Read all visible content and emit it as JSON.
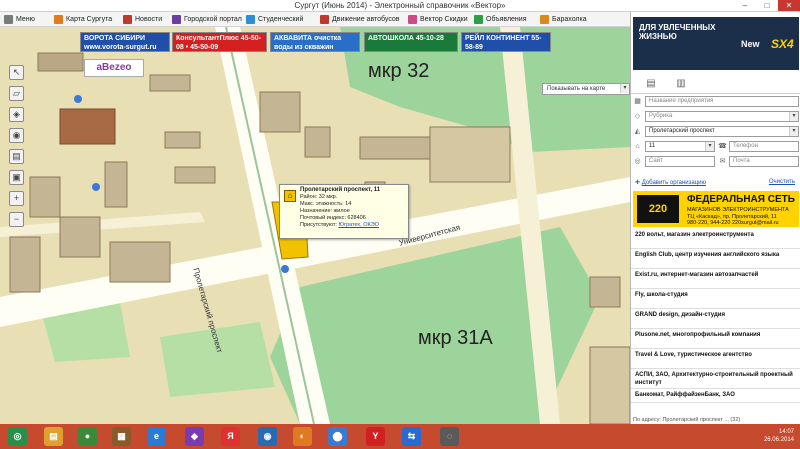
{
  "window": {
    "title": "Сургут (Июнь 2014) - Электронный справочник «Вектор»",
    "minimize": "–",
    "maximize": "□",
    "close": "✕"
  },
  "menu": [
    {
      "label": "Меню",
      "color": "#7a7a7a"
    },
    {
      "label": "Карта Сургута",
      "color": "#e07b1f"
    },
    {
      "label": "Новости",
      "color": "#c0392b"
    },
    {
      "label": "Городской портал",
      "color": "#6b3fa0"
    },
    {
      "label": "Студенческий",
      "color": "#2a8fd6"
    },
    {
      "label": "Движение автобусов",
      "color": "#c0392b"
    },
    {
      "label": "Вектор Скидки",
      "color": "#d04a8a"
    },
    {
      "label": "Объявления",
      "color": "#2e9e48"
    },
    {
      "label": "Барахолка",
      "color": "#d88a1f"
    }
  ],
  "banners": [
    {
      "text": "ВОРОТА СИБИРИ www.vorota-surgut.ru",
      "bg": "#1f4fa8",
      "fg": "#ffffff"
    },
    {
      "text": "КонсультантПлюс 45-50-08 • 45-50-09",
      "bg": "#d32020",
      "fg": "#ffffff"
    },
    {
      "text": "АКВАВИТА очистка воды из скважин",
      "bg": "#2a6fc7",
      "fg": "#ffffff"
    },
    {
      "text": "АВТОШКОЛА 45-10-28",
      "bg": "#1a7a3a",
      "fg": "#ffffff"
    },
    {
      "text": "РЕЙЛ КОНТИНЕНТ 55-58-89",
      "bg": "#1f4fa8",
      "fg": "#ffffff"
    }
  ],
  "map": {
    "logo": "аВеzео",
    "show_on_map": "Показывать на карте",
    "district_1": "мкр 32",
    "district_2": "мкр 31А",
    "street_1": "Пролетарский проспект",
    "street_2": "Университетская"
  },
  "popup": {
    "title": "Пролетарский проспект, 11",
    "lines": [
      "Район: 32 мкр.",
      "Макс. этажность: 14",
      "Назначение: жилое",
      "Почтовый индекс: 628406"
    ],
    "present_label": "Присутствуют:",
    "present_links": "Югратех, ОКЭО"
  },
  "panel": {
    "ad_top_line1": "ДЛЯ УВЛЕЧЕННЫХ",
    "ad_top_line2": "ЖИЗНЬЮ",
    "ad_top_brand": "New",
    "ad_top_model": "SX4",
    "company_placeholder": "Название предприятия",
    "rubric_placeholder": "Рубрика",
    "street_value": "Пролетарский проспект",
    "house_value": "11",
    "phone_placeholder": "Телефон",
    "site_placeholder": "Сайт",
    "mail_placeholder": "Почта",
    "add_org": "Добавить организацию",
    "clear": "Очистить",
    "yad": {
      "logo": "220",
      "title": "ФЕДЕРАЛЬНАЯ СЕТЬ",
      "line1": "МАГАЗИНОВ ЭЛЕКТРОИНСТРУМЕНТА",
      "line2": "ТЦ «Каскад», пр. Пролетарский, 11",
      "line3": "980-220, 944-220  220surgut@mail.ru"
    },
    "list": [
      "220 вольт, магазин электроинструмента",
      "English Club, центр изучения английского языка",
      "Exist.ru, интернет-магазин автозапчастей",
      "Fly, школа-студия",
      "GRAND design, дизайн-студия",
      "Plusone.net, многопрофильный компания",
      "Travel & Love, туристическое агентство",
      "АСПИ, ЗАО, Архитектурно-строительный проектный институт",
      "Банкомат, РайффайзенБанк, ЗАО",
      "Банкоматы, Сбербанк России"
    ],
    "footer": "По адресу: Пролетарский проспект ... (32)"
  },
  "taskbar": {
    "time": "14:07",
    "date": "26.06.2014",
    "items": [
      {
        "name": "start",
        "color": "#2a8f4a",
        "glyph": "◎"
      },
      {
        "name": "explorer",
        "color": "#e0a030",
        "glyph": "▤"
      },
      {
        "name": "chrome",
        "color": "#3a8a3a",
        "glyph": "●"
      },
      {
        "name": "tool",
        "color": "#8a5a2a",
        "glyph": "▦"
      },
      {
        "name": "ie",
        "color": "#2a7ad6",
        "glyph": "e"
      },
      {
        "name": "vs",
        "color": "#7a3ab0",
        "glyph": "◆"
      },
      {
        "name": "yandex",
        "color": "#e03030",
        "glyph": "Я"
      },
      {
        "name": "media",
        "color": "#2a6ab0",
        "glyph": "◉"
      },
      {
        "name": "firefox",
        "color": "#e07a20",
        "glyph": "◐"
      },
      {
        "name": "skype",
        "color": "#3a7ad0",
        "glyph": "⬤"
      },
      {
        "name": "yabrowser",
        "color": "#d02020",
        "glyph": "Y"
      },
      {
        "name": "teamviewer",
        "color": "#2a6ad0",
        "glyph": "⇆"
      },
      {
        "name": "vector",
        "color": "#5a5a5a",
        "glyph": "◌"
      }
    ]
  }
}
